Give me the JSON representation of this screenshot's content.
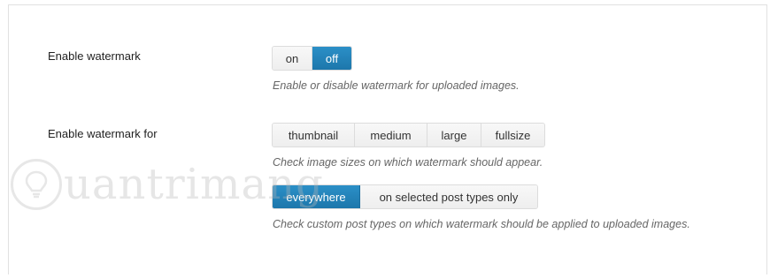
{
  "settings": {
    "enable_watermark": {
      "label": "Enable watermark",
      "options": [
        "on",
        "off"
      ],
      "selected": "off",
      "description": "Enable or disable watermark for uploaded images."
    },
    "enable_watermark_for": {
      "label": "Enable watermark for",
      "sizes": {
        "options": [
          "thumbnail",
          "medium",
          "large",
          "fullsize"
        ],
        "description": "Check image sizes on which watermark should appear."
      },
      "post_types": {
        "options": [
          "everywhere",
          "on selected post types only"
        ],
        "selected": "everywhere",
        "description": "Check custom post types on which watermark should be applied to uploaded images."
      }
    }
  },
  "watermark_overlay": {
    "text": "uantrimang",
    "icon": "lightbulb-icon"
  },
  "colors": {
    "active_button": "#1d77ab",
    "description_text": "#666666"
  }
}
